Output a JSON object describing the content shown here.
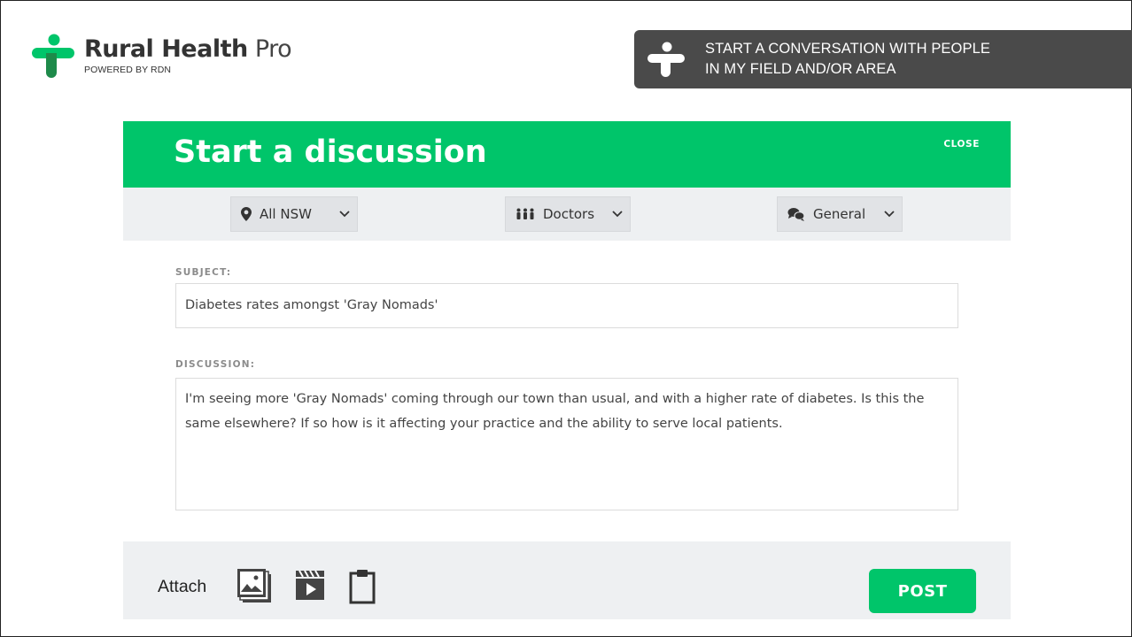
{
  "brand": {
    "name_bold": "Rural Health",
    "name_light": "Pro",
    "tagline": "POWERED BY RDN",
    "logo_icon": "plus-person-icon",
    "accent_color": "#00c56a"
  },
  "banner": {
    "line1": "START A CONVERSATION WITH PEOPLE",
    "line2": "IN MY FIELD AND/OR AREA",
    "icon": "plus-person-icon",
    "background": "#4a4a4a"
  },
  "modal": {
    "title": "Start a discussion",
    "close_label": "CLOSE"
  },
  "filters": {
    "location": {
      "value": "All NSW",
      "icon": "map-pin-icon"
    },
    "role": {
      "value": "Doctors",
      "icon": "people-icon"
    },
    "topic": {
      "value": "General",
      "icon": "chat-bubbles-icon"
    }
  },
  "form": {
    "subject_label": "SUBJECT:",
    "subject_value": "Diabetes rates amongst 'Gray Nomads'",
    "discussion_label": "DISCUSSION:",
    "discussion_value": "I'm seeing more 'Gray Nomads' coming through our town than usual, and with a higher rate of diabetes. Is this the same elsewhere? If so how is it affecting your practice and the ability to serve local patients."
  },
  "footer": {
    "attach_label": "Attach",
    "attach_icons": [
      "image-icon",
      "video-icon",
      "clipboard-icon"
    ],
    "post_label": "POST"
  }
}
